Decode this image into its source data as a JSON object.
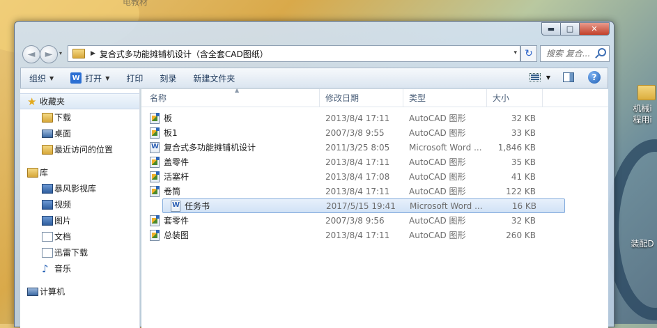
{
  "desktop": {
    "top_label": "电教材",
    "icons": [
      {
        "label_line1": "机械i",
        "label_line2": "程用i"
      },
      {
        "label_line1": "装配D",
        "label_line2": ""
      }
    ]
  },
  "window": {
    "caption_buttons": {
      "minimize": "▬",
      "maximize": "□",
      "close": "✕"
    }
  },
  "navigation": {
    "back_icon": "◄",
    "forward_icon": "►",
    "recent_icon": "▾",
    "address_separator": "▶",
    "address_path": "复合式多功能摊铺机设计（含全套CAD图纸）",
    "address_dropdown": "▾",
    "refresh_icon": "↻",
    "search_placeholder": "搜索 复合..."
  },
  "toolbar": {
    "organize": "组织",
    "open": "打开",
    "open_icon_letter": "W",
    "print": "打印",
    "burn": "刻录",
    "new_folder": "新建文件夹",
    "caret": "▼",
    "help": "?"
  },
  "sidebar": {
    "favorites": {
      "label": "收藏夹",
      "items": [
        "下载",
        "桌面",
        "最近访问的位置"
      ]
    },
    "libraries": {
      "label": "库",
      "items": [
        "暴风影视库",
        "视频",
        "图片",
        "文档",
        "迅雷下载",
        "音乐"
      ]
    },
    "computer": {
      "label": "计算机"
    }
  },
  "columns": {
    "name": "名称",
    "date": "修改日期",
    "type": "类型",
    "size": "大小",
    "sort_indicator": "▲"
  },
  "files": [
    {
      "name": "板",
      "date": "2013/8/4 17:11",
      "type": "AutoCAD 图形",
      "size": "32 KB",
      "icon": "cad-file-icon"
    },
    {
      "name": "板1",
      "date": "2007/3/8 9:55",
      "type": "AutoCAD 图形",
      "size": "33 KB",
      "icon": "cad-file-icon"
    },
    {
      "name": "复合式多功能摊铺机设计",
      "date": "2011/3/25 8:05",
      "type": "Microsoft Word ...",
      "size": "1,846 KB",
      "icon": "word-file-icon"
    },
    {
      "name": "盖零件",
      "date": "2013/8/4 17:11",
      "type": "AutoCAD 图形",
      "size": "35 KB",
      "icon": "cad-file-icon"
    },
    {
      "name": "活塞杆",
      "date": "2013/8/4 17:08",
      "type": "AutoCAD 图形",
      "size": "41 KB",
      "icon": "cad-file-icon"
    },
    {
      "name": "卷筒",
      "date": "2013/8/4 17:11",
      "type": "AutoCAD 图形",
      "size": "122 KB",
      "icon": "cad-file-icon"
    },
    {
      "name": "任务书",
      "date": "2017/5/15 19:41",
      "type": "Microsoft Word ...",
      "size": "16 KB",
      "icon": "word-file-icon",
      "selected": true
    },
    {
      "name": "套零件",
      "date": "2007/3/8 9:56",
      "type": "AutoCAD 图形",
      "size": "32 KB",
      "icon": "cad-file-icon"
    },
    {
      "name": "总装图",
      "date": "2013/8/4 17:11",
      "type": "AutoCAD 图形",
      "size": "260 KB",
      "icon": "cad-file-icon"
    }
  ]
}
